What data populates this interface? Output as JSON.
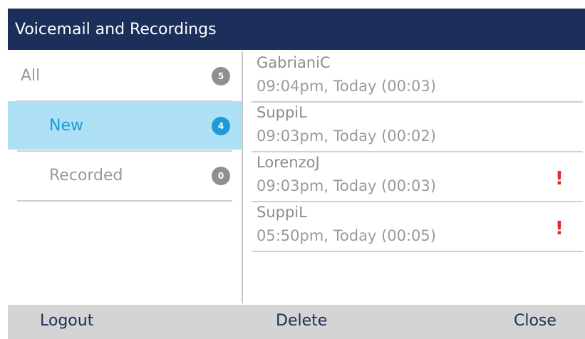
{
  "header": {
    "title": "Voicemail and Recordings"
  },
  "folders": [
    {
      "label": "All",
      "count": "5"
    },
    {
      "label": "New",
      "count": "4"
    },
    {
      "label": "Recorded",
      "count": "0"
    }
  ],
  "selected_folder": "New",
  "messages": [
    {
      "name": "GabrianiC",
      "meta": "09:04pm, Today (00:03)",
      "urgent": ""
    },
    {
      "name": "SuppiL",
      "meta": "09:03pm, Today (00:02)",
      "urgent": ""
    },
    {
      "name": "LorenzoJ",
      "meta": "09:03pm, Today (00:03)",
      "urgent": "!"
    },
    {
      "name": "SuppiL",
      "meta": "05:50pm, Today (00:05)",
      "urgent": "!"
    }
  ],
  "softkeys": {
    "left": "Logout",
    "center": "Delete",
    "right": "Close"
  },
  "colors": {
    "header_bg": "#1c2f5b",
    "selected_bg": "#aee1f5",
    "selected_text": "#1f9ad6",
    "urgent": "#e8242c",
    "footer_bg": "#d4d4d4"
  }
}
